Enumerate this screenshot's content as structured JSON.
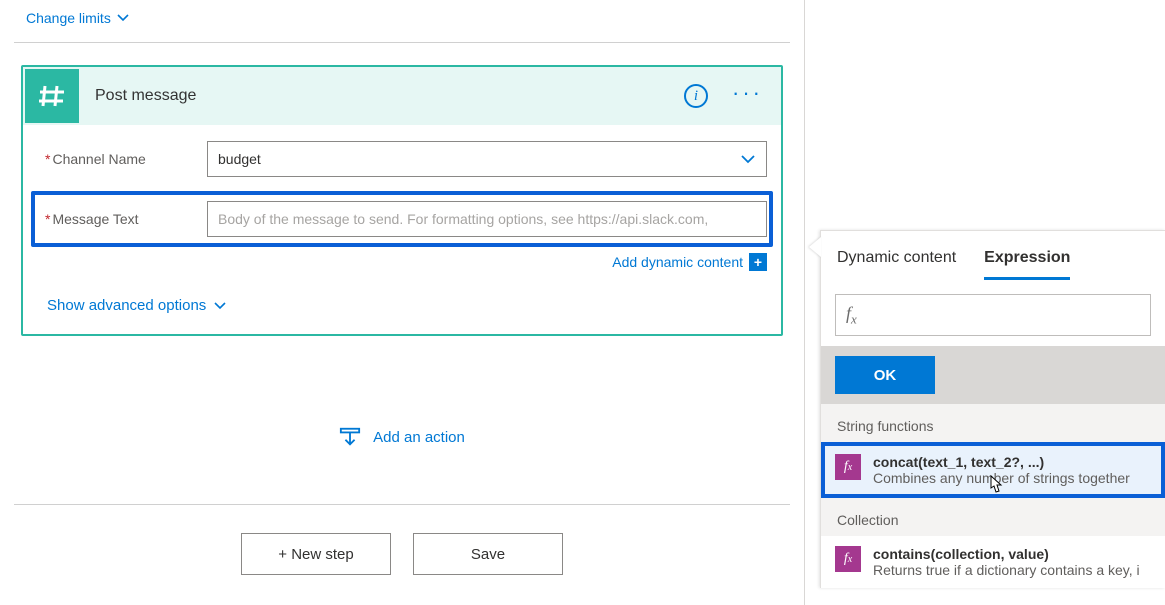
{
  "topLink": {
    "label": "Change limits"
  },
  "card": {
    "title": "Post message",
    "field1_label": "Channel Name",
    "field1_value": "budget",
    "field2_label": "Message Text",
    "field2_placeholder": "Body of the message to send. For formatting options, see https://api.slack.com,",
    "dynamic_link": "Add dynamic content",
    "adv_options": "Show advanced options"
  },
  "addAction": "Add an action",
  "buttons": {
    "newStep": "+ New step",
    "save": "Save"
  },
  "flyout": {
    "tab1": "Dynamic content",
    "tab2": "Expression",
    "ok": "OK",
    "section1": "String functions",
    "fn1_sig": "concat(text_1, text_2?, ...)",
    "fn1_desc": "Combines any number of strings together",
    "section2": "Collection",
    "fn2_sig": "contains(collection, value)",
    "fn2_desc": "Returns true if a dictionary contains a key, i"
  }
}
